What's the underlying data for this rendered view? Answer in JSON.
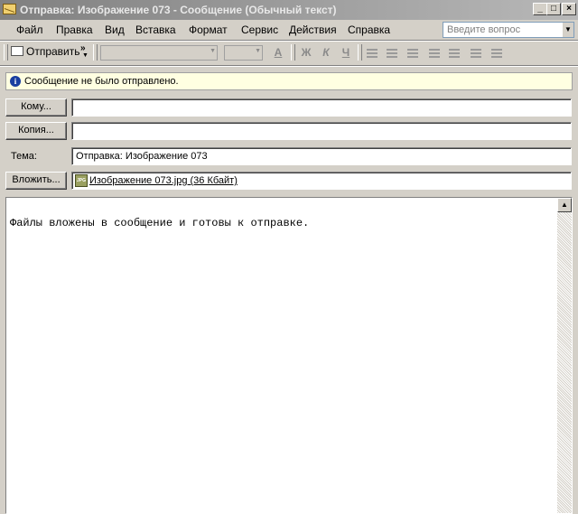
{
  "window": {
    "title": "Отправка: Изображение 073 - Сообщение (Обычный текст)",
    "controls": {
      "minimize": "_",
      "maximize": "□",
      "close": "×"
    }
  },
  "menu": {
    "items": [
      "Файл",
      "Правка",
      "Вид",
      "Вставка",
      "Формат",
      "Сервис",
      "Действия",
      "Справка"
    ],
    "ask_placeholder": "Введите вопрос"
  },
  "toolbar": {
    "send_label": "Отправить",
    "overflow": "»",
    "font_color_glyph": "A",
    "bold_glyph": "Ж",
    "italic_glyph": "К",
    "underline_glyph": "Ч"
  },
  "infobar": {
    "icon": "info-icon",
    "text": "Сообщение не было отправлено."
  },
  "fields": {
    "to_button": "Кому...",
    "to_value": "",
    "cc_button": "Копия...",
    "cc_value": "",
    "subject_label": "Тема:",
    "subject_value": "Отправка: Изображение 073",
    "attach_button": "Вложить...",
    "attachment_icon_text": "JPG",
    "attachment": "Изображение 073.jpg (36 Кбайт)"
  },
  "body": {
    "text": "Файлы вложены в сообщение и готовы к отправке."
  }
}
